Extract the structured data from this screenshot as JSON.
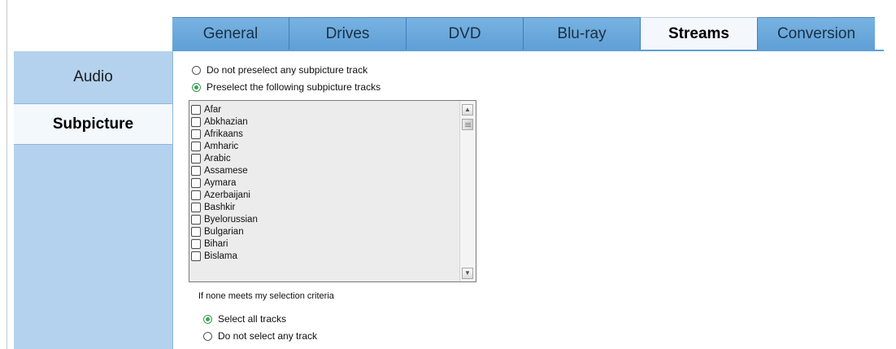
{
  "tabs": [
    {
      "label": "General",
      "active": false
    },
    {
      "label": "Drives",
      "active": false
    },
    {
      "label": "DVD",
      "active": false
    },
    {
      "label": "Blu-ray",
      "active": false
    },
    {
      "label": "Streams",
      "active": true
    },
    {
      "label": "Conversion",
      "active": false
    }
  ],
  "sidenav": {
    "items": [
      {
        "label": "Audio",
        "active": false
      },
      {
        "label": "Subpicture",
        "active": true
      }
    ]
  },
  "preselect": {
    "none_label": "Do not preselect any subpicture track",
    "following_label": "Preselect the following subpicture tracks",
    "selected": "following"
  },
  "languages": [
    "Afar",
    "Abkhazian",
    "Afrikaans",
    "Amharic",
    "Arabic",
    "Assamese",
    "Aymara",
    "Azerbaijani",
    "Bashkir",
    "Byelorussian",
    "Bulgarian",
    "Bihari",
    "Bislama"
  ],
  "fallback": {
    "caption": "If none meets my selection criteria",
    "select_all_label": "Select all tracks",
    "select_none_label": "Do not select any track",
    "selected": "all"
  },
  "colors": {
    "tab_blue": "#5e9fd6",
    "side_blue": "#b4d2ee",
    "radio_green": "#27b04a"
  }
}
